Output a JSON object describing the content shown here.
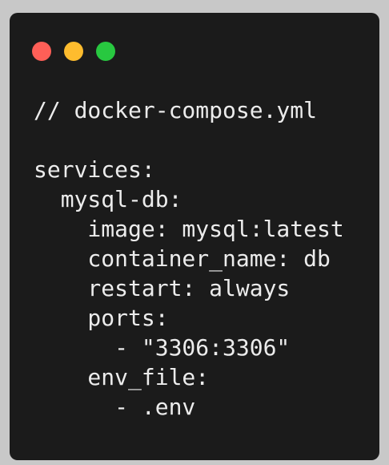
{
  "window": {
    "controls": [
      {
        "name": "close",
        "color": "#ff5f57"
      },
      {
        "name": "minimize",
        "color": "#febc2e"
      },
      {
        "name": "maximize",
        "color": "#28c840"
      }
    ]
  },
  "code": {
    "lines": [
      "// docker-compose.yml",
      "",
      "services:",
      "  mysql-db:",
      "    image: mysql:latest",
      "    container_name: db",
      "    restart: always",
      "    ports:",
      "      - \"3306:3306\"",
      "    env_file:",
      "      - .env"
    ]
  }
}
